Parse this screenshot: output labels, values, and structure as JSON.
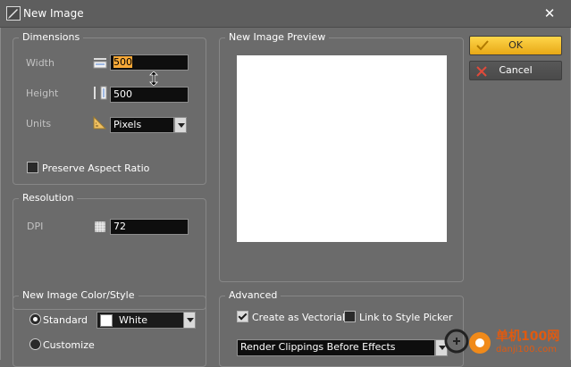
{
  "window": {
    "title": "New Image",
    "close_icon": "close-icon"
  },
  "dimensions": {
    "title": "Dimensions",
    "width_label": "Width",
    "width_value": "500",
    "height_label": "Height",
    "height_value": "500",
    "units_label": "Units",
    "units_value": "Pixels",
    "preserve_label": "Preserve Aspect Ratio",
    "preserve_checked": false
  },
  "resolution": {
    "title": "Resolution",
    "dpi_label": "DPI",
    "dpi_value": "72"
  },
  "color_style": {
    "title": "New Image Color/Style",
    "standard_label": "Standard",
    "color_value": "White",
    "customize_label": "Customize"
  },
  "preview": {
    "title": "New Image Preview",
    "canvas_color": "#ffffff"
  },
  "advanced": {
    "title": "Advanced",
    "vectorial_label": "Create as Vectorial",
    "vectorial_checked": true,
    "link_style_label": "Link to Style Picker",
    "link_style_checked": false,
    "render_value": "Render Clippings Before Effects"
  },
  "buttons": {
    "ok": "OK",
    "cancel": "Cancel"
  },
  "watermark": {
    "line1": "单机100网",
    "line2": "danji100.com"
  },
  "colors": {
    "ok_accent": "#f0b52a",
    "cancel_icon": "#e04a3a",
    "selection": "#f7a938"
  }
}
